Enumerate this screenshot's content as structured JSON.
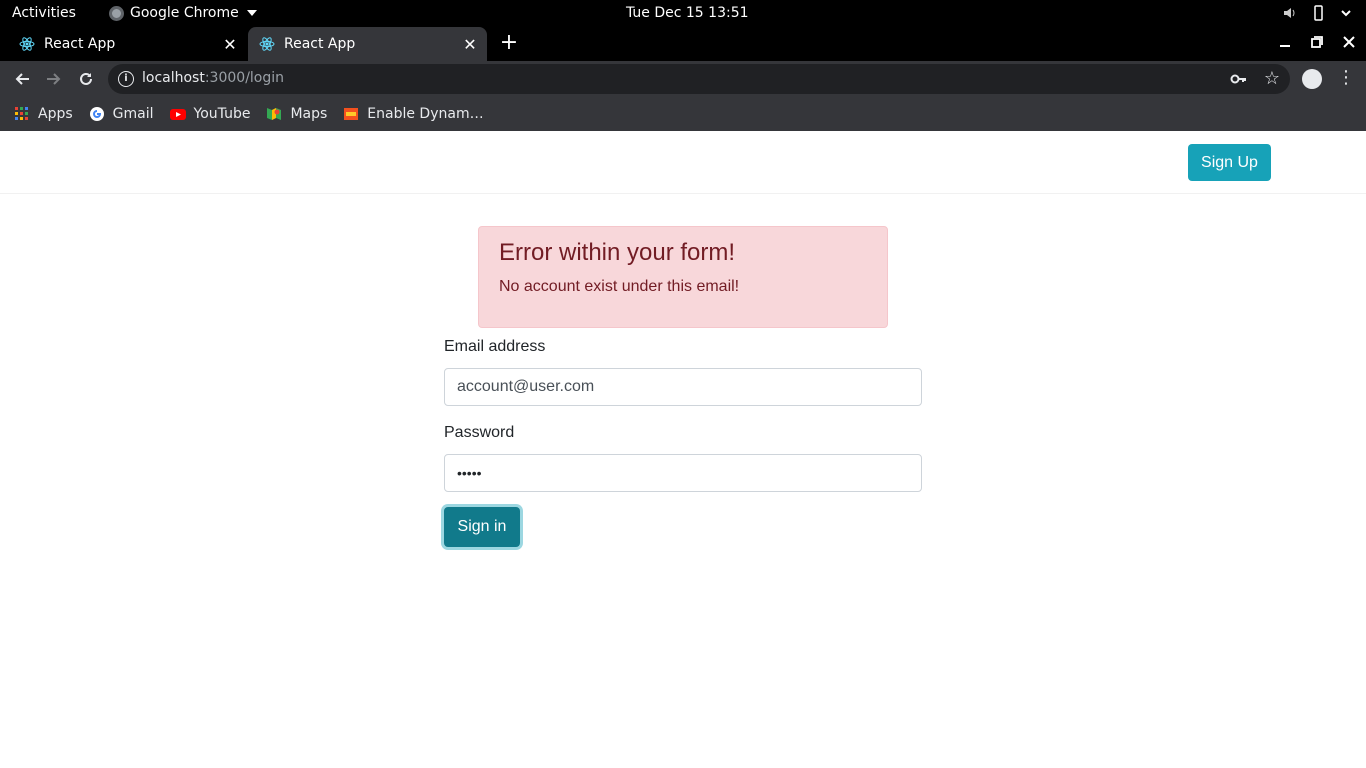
{
  "system": {
    "activities": "Activities",
    "app_name": "Google Chrome",
    "clock": "Tue Dec 15  13:51"
  },
  "tabs": [
    {
      "title": "React App",
      "active": false
    },
    {
      "title": "React App",
      "active": true
    }
  ],
  "address_bar": {
    "host": "localhost",
    "path": ":3000/login"
  },
  "bookmarks": [
    {
      "label": "Apps",
      "icon": "apps-grid-icon"
    },
    {
      "label": "Gmail",
      "icon": "google-icon"
    },
    {
      "label": "YouTube",
      "icon": "youtube-icon"
    },
    {
      "label": "Maps",
      "icon": "maps-icon"
    },
    {
      "label": "Enable Dynam…",
      "icon": "extension-icon"
    }
  ],
  "navbar": {
    "signup_label": "Sign Up"
  },
  "alert": {
    "heading": "Error within your form!",
    "message": "No account exist under this email!"
  },
  "form": {
    "email_label": "Email address",
    "email_value": "account@user.com",
    "password_label": "Password",
    "password_mask": "•••••",
    "signin_label": "Sign in"
  },
  "colors": {
    "info": "#17a2b8",
    "alert_bg": "#f8d7da",
    "alert_text": "#721c24"
  }
}
